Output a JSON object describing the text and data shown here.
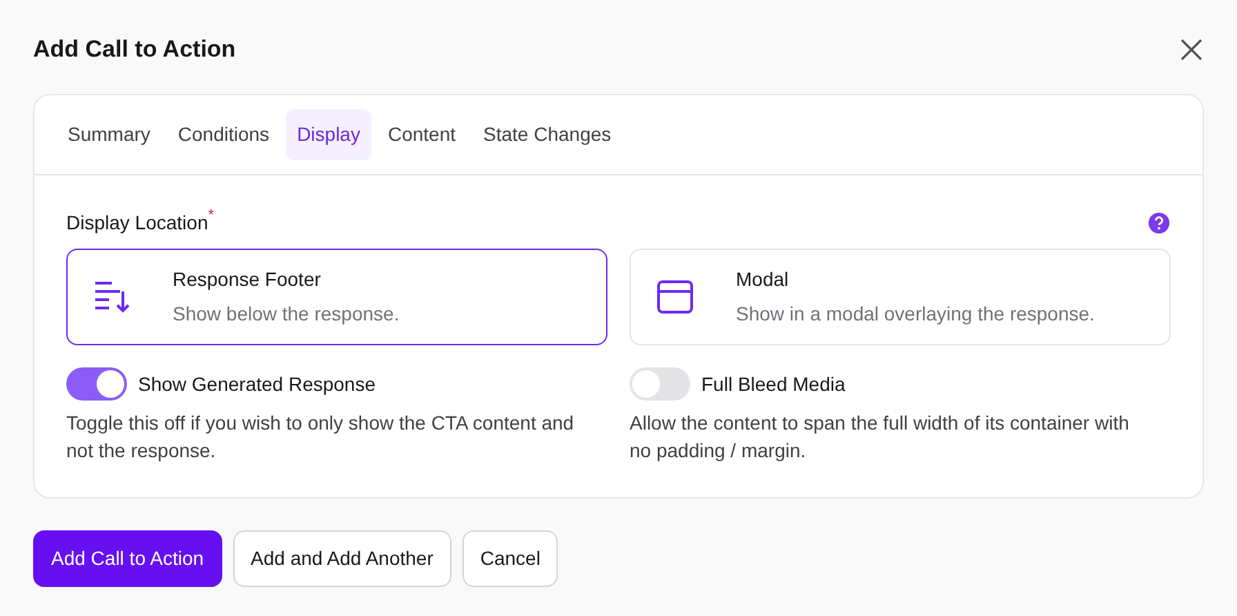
{
  "dialog": {
    "title": "Add Call to Action"
  },
  "tabs": [
    {
      "label": "Summary",
      "selected": false
    },
    {
      "label": "Conditions",
      "selected": false
    },
    {
      "label": "Display",
      "selected": true
    },
    {
      "label": "Content",
      "selected": false
    },
    {
      "label": "State Changes",
      "selected": false
    }
  ],
  "display_location": {
    "label": "Display Location",
    "required_mark": "*",
    "options": [
      {
        "kind": "footer",
        "title": "Response Footer",
        "description": "Show below the response.",
        "selected": true
      },
      {
        "kind": "modal",
        "title": "Modal",
        "description": "Show in a modal overlaying the response.",
        "selected": false
      }
    ]
  },
  "toggles": [
    {
      "label": "Show Generated Response",
      "on": true,
      "description": "Toggle this off if you wish to only show the CTA content and not the response."
    },
    {
      "label": "Full Bleed Media",
      "on": false,
      "description": "Allow the content to span the full width of its container with no padding / margin."
    }
  ],
  "buttons": [
    {
      "label": "Add Call to Action",
      "kind": "primary"
    },
    {
      "label": "Add and Add Another",
      "kind": "secondary"
    },
    {
      "label": "Cancel",
      "kind": "secondary"
    }
  ]
}
